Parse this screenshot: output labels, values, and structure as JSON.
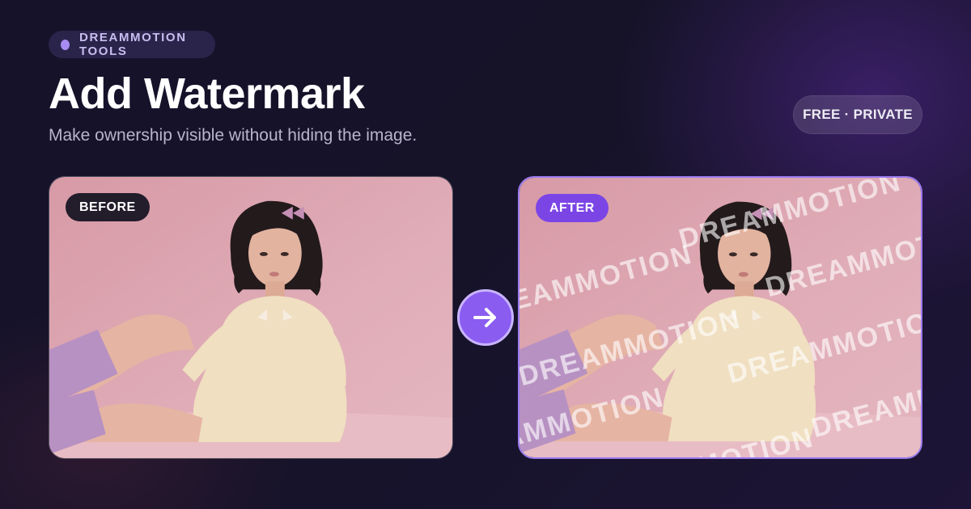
{
  "brand": {
    "label": "DREAMMOTION TOOLS",
    "dot_color": "#a98cf2"
  },
  "header": {
    "title": "Add Watermark",
    "subtitle": "Make ownership visible without hiding the image."
  },
  "badge": {
    "label": "FREE · PRIVATE"
  },
  "before_panel": {
    "tag": "BEFORE",
    "tag_color": "#221c2b"
  },
  "after_panel": {
    "tag": "AFTER",
    "tag_color": "#7b45e6",
    "border_color": "#9b7bf0",
    "watermark_text": "DREAMMOTION"
  },
  "arrow": {
    "icon": "arrow-right-icon",
    "color": "#8a5cf0"
  },
  "colors": {
    "background": "#16132a",
    "accent": "#7b45e6",
    "photo_bg": "#dca7b2"
  }
}
